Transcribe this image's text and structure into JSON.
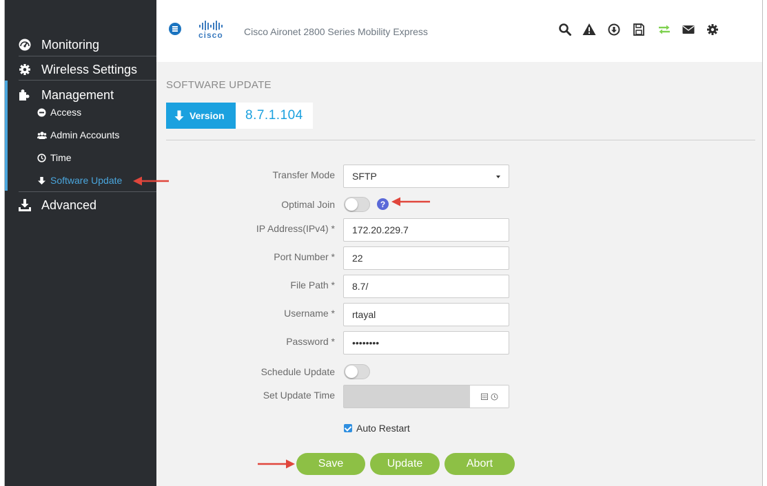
{
  "colors": {
    "sidebar_bg": "#2a2d31",
    "accent_blue": "#1ba1df",
    "active_link": "#4aa6dd",
    "button_green": "#8dc045",
    "annotation_red": "#e0463c"
  },
  "sidebar": {
    "items": [
      {
        "label": "Monitoring",
        "icon": "dashboard-icon"
      },
      {
        "label": "Wireless Settings",
        "icon": "gear-icon"
      },
      {
        "label": "Management",
        "icon": "puzzle-icon"
      },
      {
        "label": "Advanced",
        "icon": "download-tray-icon"
      }
    ],
    "management_sub": [
      {
        "label": "Access",
        "icon": "minus-circle-icon"
      },
      {
        "label": "Admin Accounts",
        "icon": "users-icon"
      },
      {
        "label": "Time",
        "icon": "clock-icon"
      },
      {
        "label": "Software Update",
        "icon": "arrow-down-icon"
      }
    ]
  },
  "header": {
    "brand": "cisco",
    "title": "Cisco Aironet 2800 Series Mobility Express",
    "toolbar_icons": [
      "search-icon",
      "alert-icon",
      "download-circle-icon",
      "save-icon",
      "transfer-icon",
      "mail-icon",
      "settings-icon"
    ]
  },
  "page": {
    "title": "SOFTWARE UPDATE",
    "version_label": "Version",
    "version_value": "8.7.1.104"
  },
  "form": {
    "transfer_mode_label": "Transfer Mode",
    "transfer_mode_value": "SFTP",
    "optimal_join_label": "Optimal Join",
    "optimal_join_on": false,
    "help_glyph": "?",
    "ip_label": "IP Address(IPv4) *",
    "ip_value": "172.20.229.7",
    "port_label": "Port Number *",
    "port_value": "22",
    "path_label": "File Path *",
    "path_value": "8.7/",
    "username_label": "Username *",
    "username_value": "rtayal",
    "password_label": "Password *",
    "password_value": "••••••••",
    "schedule_label": "Schedule Update",
    "schedule_on": false,
    "update_time_label": "Set Update Time",
    "update_time_value": "",
    "auto_restart_label": "Auto Restart",
    "auto_restart_checked": true
  },
  "buttons": {
    "save": "Save",
    "update": "Update",
    "abort": "Abort"
  }
}
